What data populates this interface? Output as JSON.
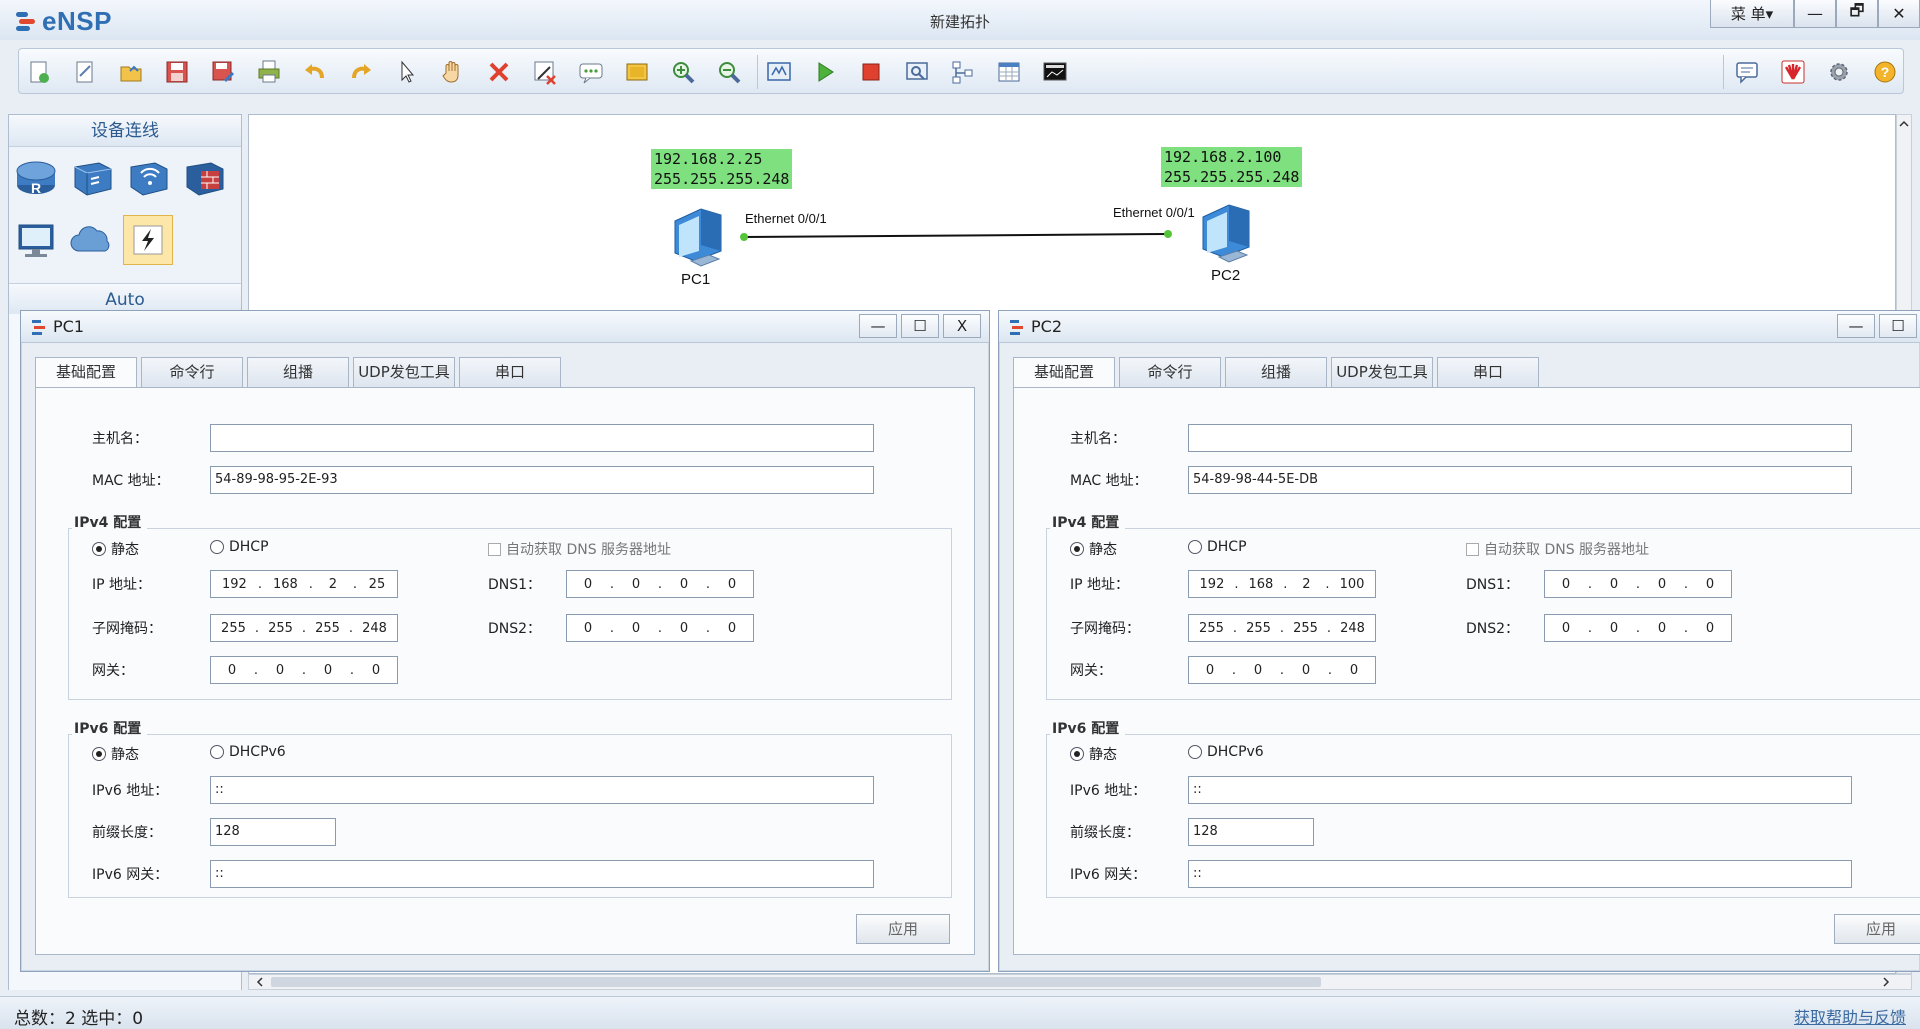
{
  "app": {
    "name": "eNSP",
    "title": "新建拓扑",
    "menu_label": "菜 单▾"
  },
  "window_controls": {
    "minimize": "—",
    "restore": "🗗",
    "close": "✕"
  },
  "toolbar": {
    "left": [
      "new-topo-icon",
      "new-example-icon",
      "open-icon",
      "save-icon",
      "save-as-icon",
      "print-icon",
      "undo-icon",
      "redo-icon",
      "select-icon",
      "pan-icon",
      "delete-icon",
      "delete-link-icon",
      "text-icon",
      "palette-icon",
      "zoom-in-icon",
      "zoom-out-icon",
      "fit-icon",
      "start-icon",
      "stop-icon",
      "capture-icon",
      "topology-icon",
      "grid-icon",
      "console-icon"
    ],
    "right": [
      "chat-icon",
      "huawei-icon",
      "settings-icon",
      "help-icon"
    ]
  },
  "device_panel": {
    "header": "设备连线",
    "devices": [
      {
        "name": "router",
        "label": "R"
      },
      {
        "name": "switch",
        "label": ""
      },
      {
        "name": "wlan",
        "label": ""
      },
      {
        "name": "firewall",
        "label": ""
      },
      {
        "name": "pc",
        "label": ""
      },
      {
        "name": "cloud",
        "label": ""
      },
      {
        "name": "connector",
        "label": ""
      }
    ],
    "footer": "Auto"
  },
  "topology": {
    "pc1": {
      "name": "PC1",
      "ip": "192.168.2.25",
      "mask": "255.255.255.248",
      "port": "Ethernet 0/0/1"
    },
    "pc2": {
      "name": "PC2",
      "ip": "192.168.2.100",
      "mask": "255.255.255.248",
      "port": "Ethernet 0/0/1"
    }
  },
  "status": {
    "left": "总数：2  选中：0",
    "right": "获取帮助与反馈"
  },
  "labels": {
    "tabs": [
      "基础配置",
      "命令行",
      "组播",
      "UDP发包工具",
      "串口"
    ],
    "hostname": "主机名：",
    "mac": "MAC 地址：",
    "ipv4_group": "IPv4 配置",
    "static": "静态",
    "dhcp": "DHCP",
    "auto_dns": "自动获取 DNS 服务器地址",
    "ip": "IP 地址：",
    "dns1": "DNS1：",
    "mask": "子网掩码：",
    "dns2": "DNS2：",
    "gateway": "网关：",
    "ipv6_group": "IPv6 配置",
    "dhcpv6": "DHCPv6",
    "ipv6_addr": "IPv6 地址：",
    "prefix": "前缀长度：",
    "ipv6_gw": "IPv6 网关：",
    "apply": "应用",
    "dot": "."
  },
  "dialogs": {
    "pc1": {
      "title": "PC1",
      "controls": {
        "min": "—",
        "max": "☐",
        "close": "X"
      },
      "hostname": "",
      "mac": "54-89-98-95-2E-93",
      "ip": [
        "192",
        "168",
        "2",
        "25"
      ],
      "mask": [
        "255",
        "255",
        "255",
        "248"
      ],
      "gateway": [
        "0",
        "0",
        "0",
        "0"
      ],
      "dns1": [
        "0",
        "0",
        "0",
        "0"
      ],
      "dns2": [
        "0",
        "0",
        "0",
        "0"
      ],
      "ipv6_addr": "::",
      "prefix": "128",
      "ipv6_gw": "::"
    },
    "pc2": {
      "title": "PC2",
      "controls": {
        "min": "—",
        "max": "☐"
      },
      "hostname": "",
      "mac": "54-89-98-44-5E-DB",
      "ip": [
        "192",
        "168",
        "2",
        "100"
      ],
      "mask": [
        "255",
        "255",
        "255",
        "248"
      ],
      "gateway": [
        "0",
        "0",
        "0",
        "0"
      ],
      "dns1": [
        "0",
        "0",
        "0",
        "0"
      ],
      "dns2": [
        "0",
        "0",
        "0",
        "0"
      ],
      "ipv6_addr": "::",
      "prefix": "128",
      "ipv6_gw": "::"
    }
  },
  "colors": {
    "ip_label_bg": "#7ee07e",
    "link_dot": "#56c43a",
    "accent": "#2f6fb3"
  }
}
